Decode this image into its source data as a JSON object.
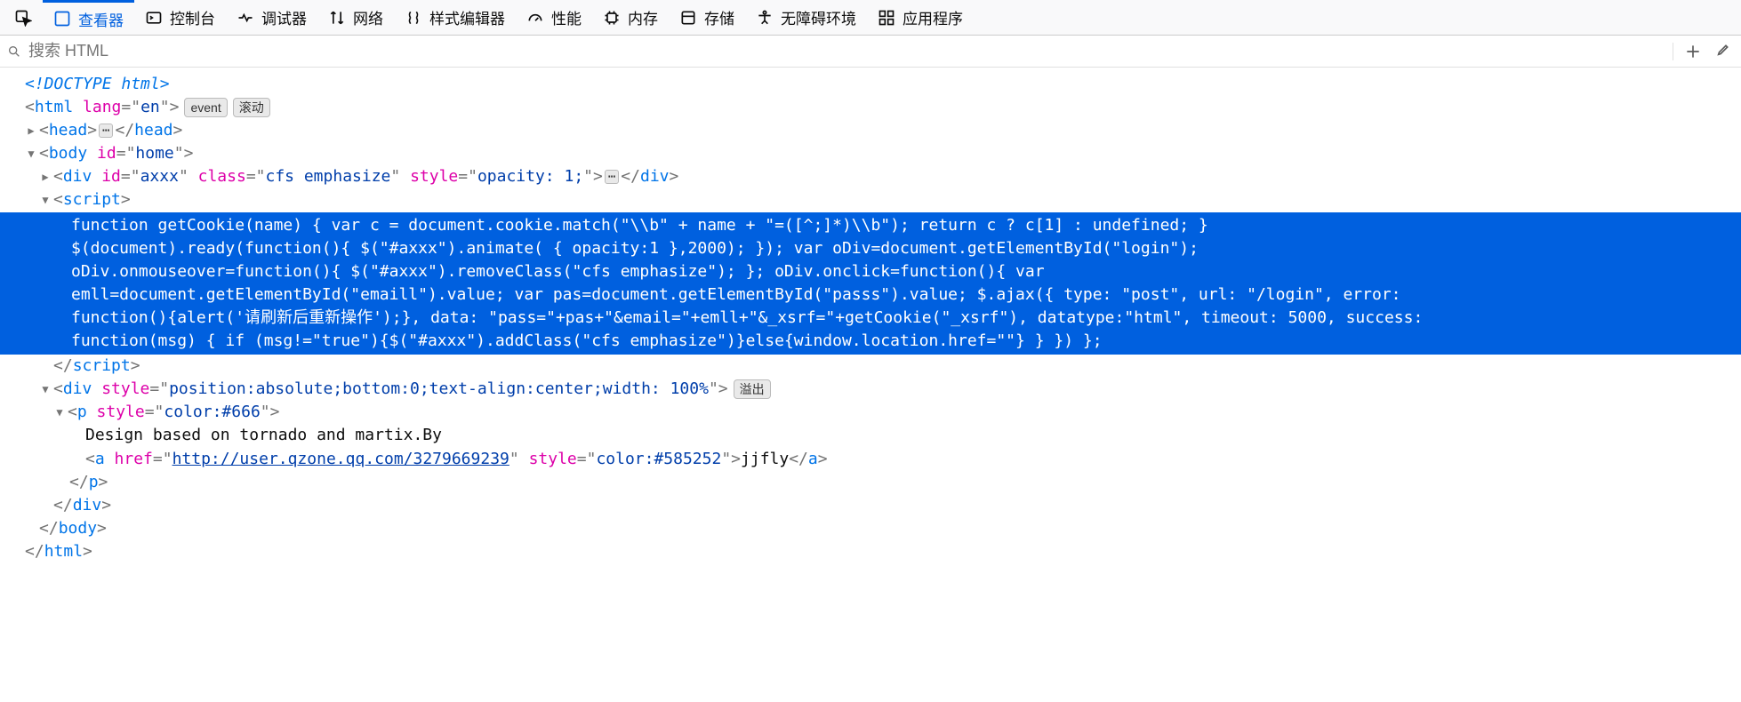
{
  "toolbar": {
    "tabs": [
      {
        "id": "picker",
        "label": ""
      },
      {
        "id": "inspector",
        "label": "查看器"
      },
      {
        "id": "console",
        "label": "控制台"
      },
      {
        "id": "debugger",
        "label": "调试器"
      },
      {
        "id": "network",
        "label": "网络"
      },
      {
        "id": "style-editor",
        "label": "样式编辑器"
      },
      {
        "id": "performance",
        "label": "性能"
      },
      {
        "id": "memory",
        "label": "内存"
      },
      {
        "id": "storage",
        "label": "存储"
      },
      {
        "id": "accessibility",
        "label": "无障碍环境"
      },
      {
        "id": "application",
        "label": "应用程序"
      }
    ]
  },
  "search": {
    "placeholder": "搜索 HTML"
  },
  "dom": {
    "doctype": "<!DOCTYPE html>",
    "html_open": {
      "lang": "en"
    },
    "badges": {
      "event": "event",
      "scroll": "滚动",
      "overflow": "溢出"
    },
    "head": "head",
    "body": {
      "id": "home"
    },
    "div1": {
      "id": "axxx",
      "class": "cfs emphasize",
      "style": "opacity: 1;"
    },
    "script_open": "script",
    "script_content": "function getCookie(name) { var c = document.cookie.match(\"\\\\b\" + name + \"=([^;]*)\\\\b\"); return c ? c[1] : undefined; }\n$(document).ready(function(){ $(\"#axxx\").animate( { opacity:1 },2000); }); var oDiv=document.getElementById(\"login\");\noDiv.onmouseover=function(){ $(\"#axxx\").removeClass(\"cfs emphasize\"); }; oDiv.onclick=function(){ var\nemll=document.getElementById(\"emaill\").value; var pas=document.getElementById(\"passs\").value; $.ajax({ type: \"post\", url: \"/login\", error:\nfunction(){alert('请刷新后重新操作');}, data: \"pass=\"+pas+\"&email=\"+emll+\"&_xsrf=\"+getCookie(\"_xsrf\"), datatype:\"html\", timeout: 5000, success:\nfunction(msg) { if (msg!=\"true\"){$(\"#axxx\").addClass(\"cfs emphasize\")}else{window.location.href=\"\"} } }) };",
    "script_close": "script",
    "div2": {
      "style": "position:absolute;bottom:0;text-align:center;width: 100%"
    },
    "p": {
      "style": "color:#666"
    },
    "p_text": "Design based on tornado and martix.By",
    "a": {
      "href": "http://user.qzone.qq.com/3279669239",
      "style": "color:#585252",
      "text": "jjfly"
    }
  }
}
